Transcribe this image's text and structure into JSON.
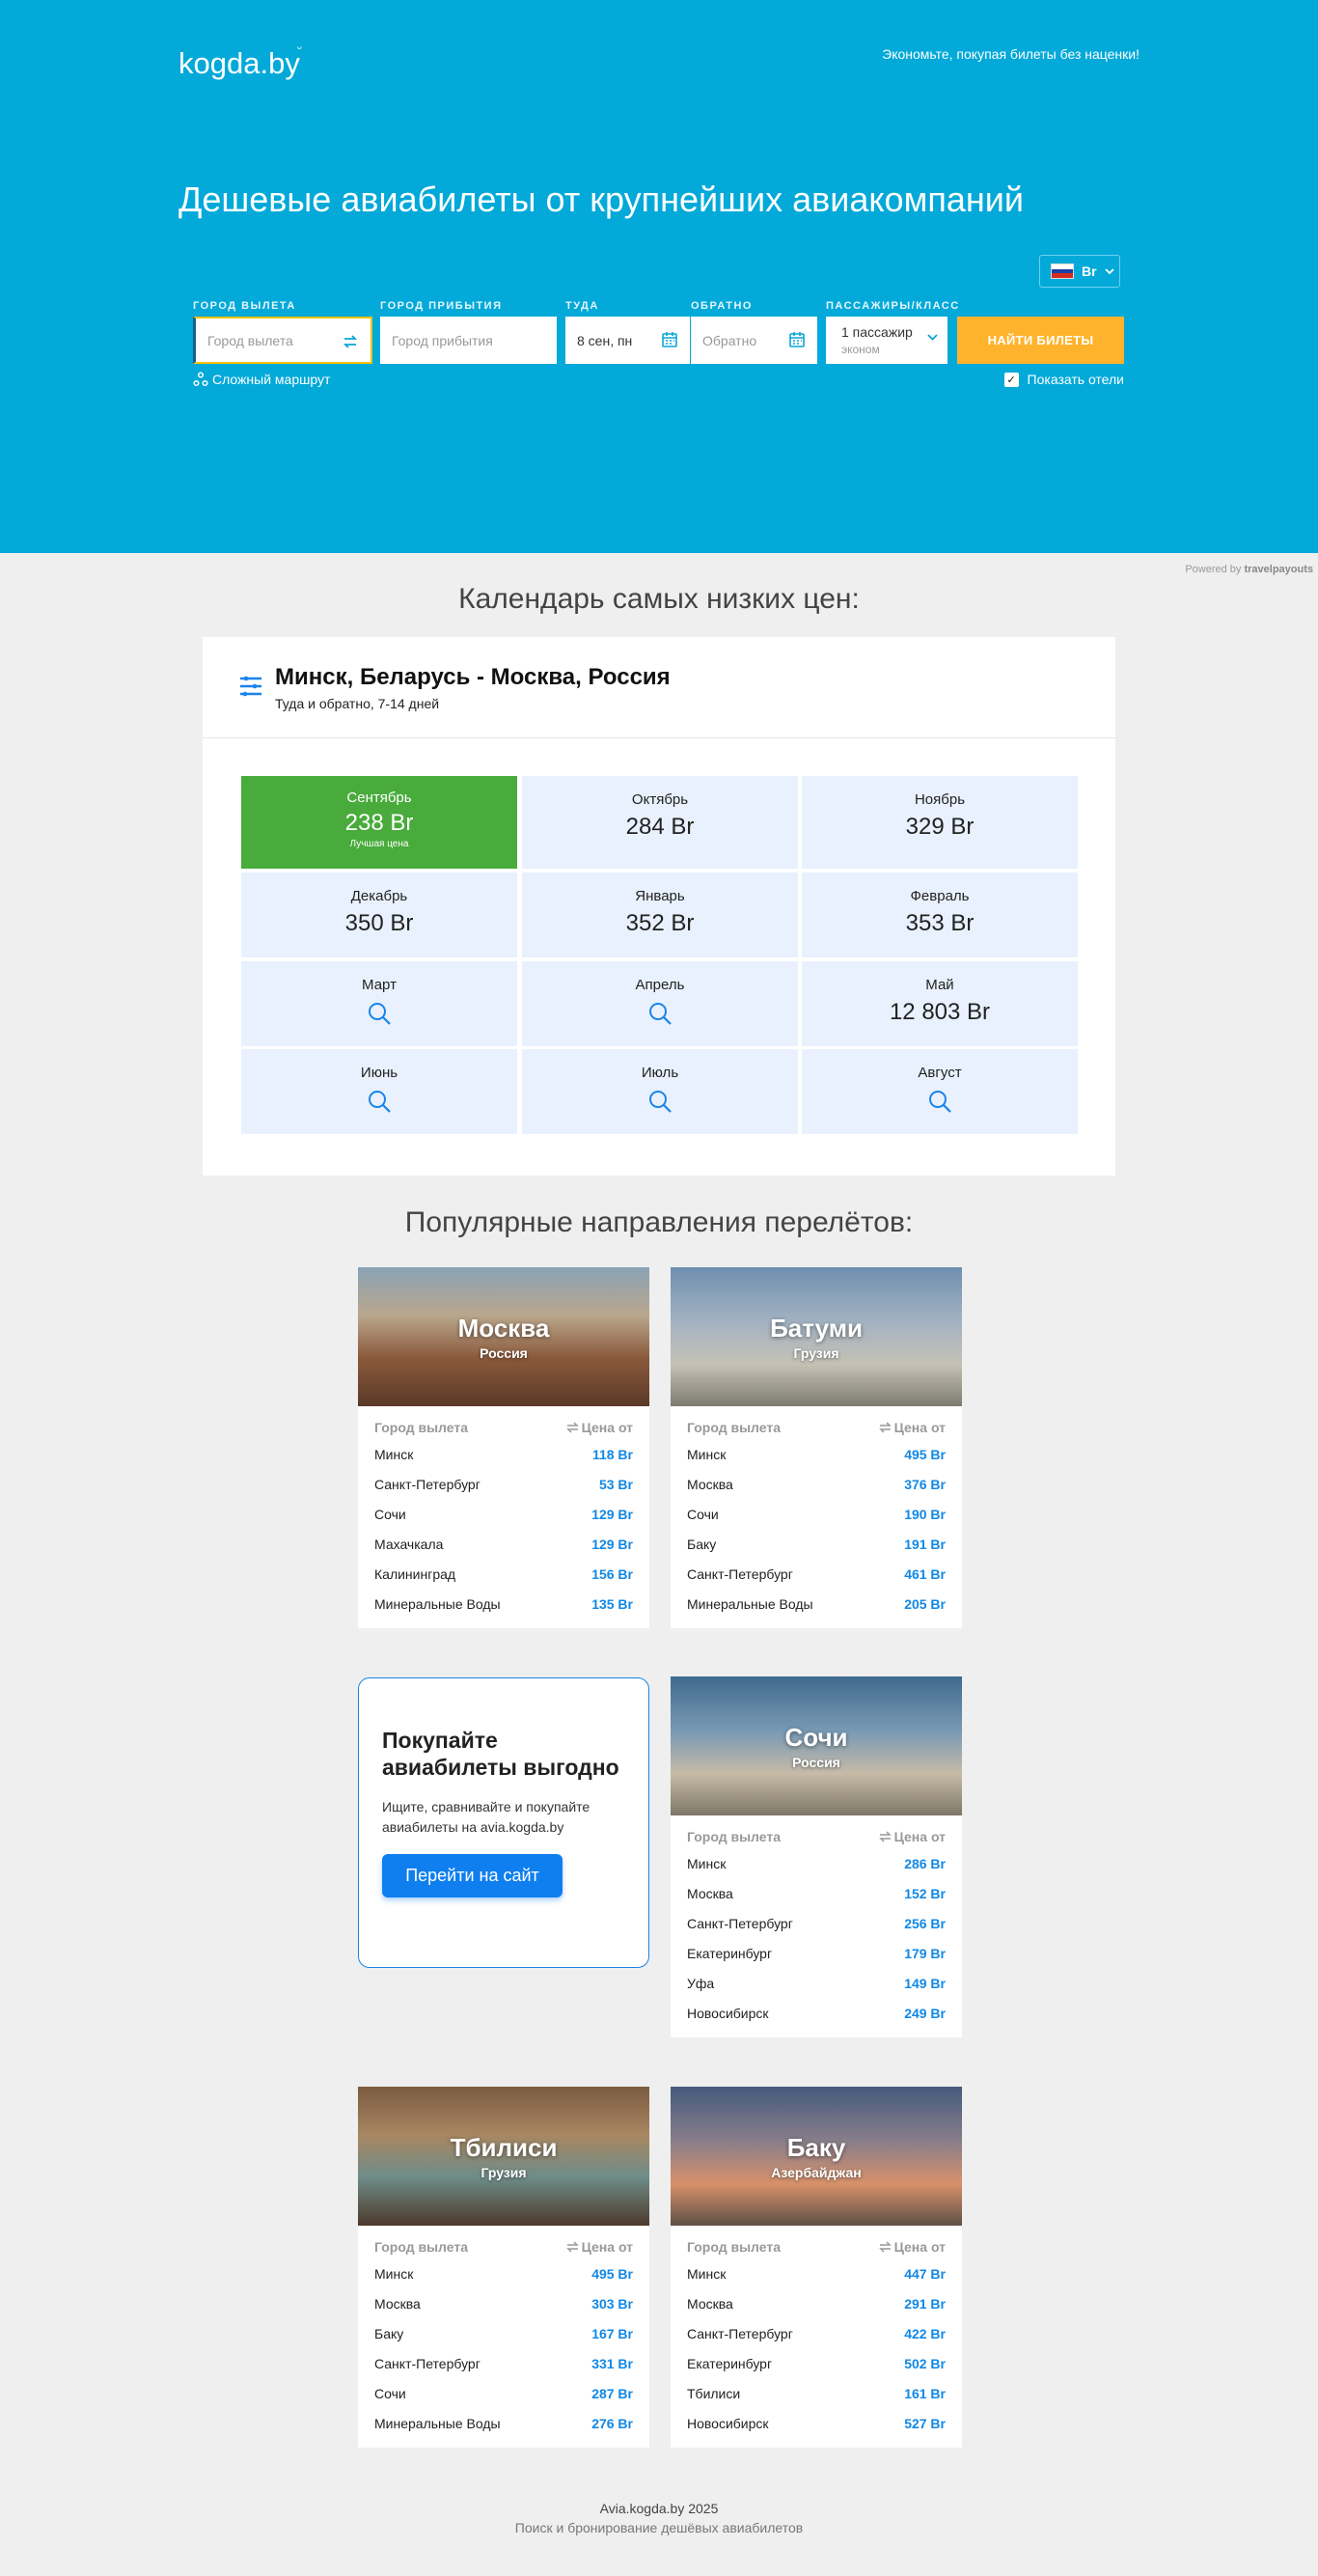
{
  "header": {
    "logo": "kogda.by",
    "tagline": "Экономьте, покупая билеты без наценки!",
    "title": "Дешевые авиабилеты от крупнейших авиакомпаний",
    "currency": "Br"
  },
  "search": {
    "from_label": "ГОРОД ВЫЛЕТА",
    "from_placeholder": "Город вылета",
    "to_label": "ГОРОД ПРИБЫТИЯ",
    "to_placeholder": "Город прибытия",
    "depart_label": "ТУДА",
    "depart_value": "8 сен, пн",
    "return_label": "ОБРАТНО",
    "return_placeholder": "Обратно",
    "pax_label": "ПАССАЖИРЫ/КЛАСС",
    "pax_value": "1 пассажир",
    "class_value": "эконом",
    "submit": "НАЙТИ БИЛЕТЫ",
    "complex_route": "Сложный маршрут",
    "show_hotels": "Показать отели"
  },
  "powered": {
    "prefix": "Powered by",
    "brand": "travelpayouts"
  },
  "calendar": {
    "heading": "Календарь самых низких цен:",
    "route": "Минск, Беларусь - Москва, Россия",
    "subtitle": "Туда и обратно, 7-14 дней",
    "best_label": "Лучшая цена",
    "months": [
      {
        "name": "Сентябрь",
        "price": "238 Br",
        "best": true
      },
      {
        "name": "Октябрь",
        "price": "284 Br"
      },
      {
        "name": "Ноябрь",
        "price": "329 Br"
      },
      {
        "name": "Декабрь",
        "price": "350 Br"
      },
      {
        "name": "Январь",
        "price": "352 Br"
      },
      {
        "name": "Февраль",
        "price": "353 Br"
      },
      {
        "name": "Март",
        "price": ""
      },
      {
        "name": "Апрель",
        "price": ""
      },
      {
        "name": "Май",
        "price": "12 803 Br"
      },
      {
        "name": "Июнь",
        "price": ""
      },
      {
        "name": "Июль",
        "price": ""
      },
      {
        "name": "Август",
        "price": ""
      }
    ]
  },
  "popular": {
    "heading": "Популярные направления перелётов:",
    "col_from": "Город вылета",
    "col_price": "Цена от",
    "cards": [
      {
        "city": "Москва",
        "country": "Россия",
        "rows": [
          [
            "Минск",
            "118 Br"
          ],
          [
            "Санкт-Петербург",
            "53 Br"
          ],
          [
            "Сочи",
            "129 Br"
          ],
          [
            "Махачкала",
            "129 Br"
          ],
          [
            "Калининград",
            "156 Br"
          ],
          [
            "Минеральные Воды",
            "135 Br"
          ]
        ]
      },
      {
        "city": "Батуми",
        "country": "Грузия",
        "rows": [
          [
            "Минск",
            "495 Br"
          ],
          [
            "Москва",
            "376 Br"
          ],
          [
            "Сочи",
            "190 Br"
          ],
          [
            "Баку",
            "191 Br"
          ],
          [
            "Санкт-Петербург",
            "461 Br"
          ],
          [
            "Минеральные Воды",
            "205 Br"
          ]
        ]
      },
      {
        "city": "Сочи",
        "country": "Россия",
        "rows": [
          [
            "Минск",
            "286 Br"
          ],
          [
            "Москва",
            "152 Br"
          ],
          [
            "Санкт-Петербург",
            "256 Br"
          ],
          [
            "Екатеринбург",
            "179 Br"
          ],
          [
            "Уфа",
            "149 Br"
          ],
          [
            "Новосибирск",
            "249 Br"
          ]
        ]
      },
      {
        "city": "Тбилиси",
        "country": "Грузия",
        "rows": [
          [
            "Минск",
            "495 Br"
          ],
          [
            "Москва",
            "303 Br"
          ],
          [
            "Баку",
            "167 Br"
          ],
          [
            "Санкт-Петербург",
            "331 Br"
          ],
          [
            "Сочи",
            "287 Br"
          ],
          [
            "Минеральные Воды",
            "276 Br"
          ]
        ]
      },
      {
        "city": "Баку",
        "country": "Азербайджан",
        "rows": [
          [
            "Минск",
            "447 Br"
          ],
          [
            "Москва",
            "291 Br"
          ],
          [
            "Санкт-Петербург",
            "422 Br"
          ],
          [
            "Екатеринбург",
            "502 Br"
          ],
          [
            "Тбилиси",
            "161 Br"
          ],
          [
            "Новосибирск",
            "527 Br"
          ]
        ]
      }
    ]
  },
  "promo": {
    "title": "Покупайте авиабилеты выгодно",
    "text": "Ищите, сравнивайте и покупайте авиабилеты на avia.kogda.by",
    "button": "Перейти на сайт"
  },
  "footer": {
    "line1": "Avia.kogda.by 2025",
    "line2": "Поиск и бронирование дешёвых авиабилетов"
  },
  "colors": {
    "hero": "#02a9d9",
    "accent_button": "#ffb32c",
    "best_price": "#48ab3b",
    "price_link": "#1188e6"
  }
}
